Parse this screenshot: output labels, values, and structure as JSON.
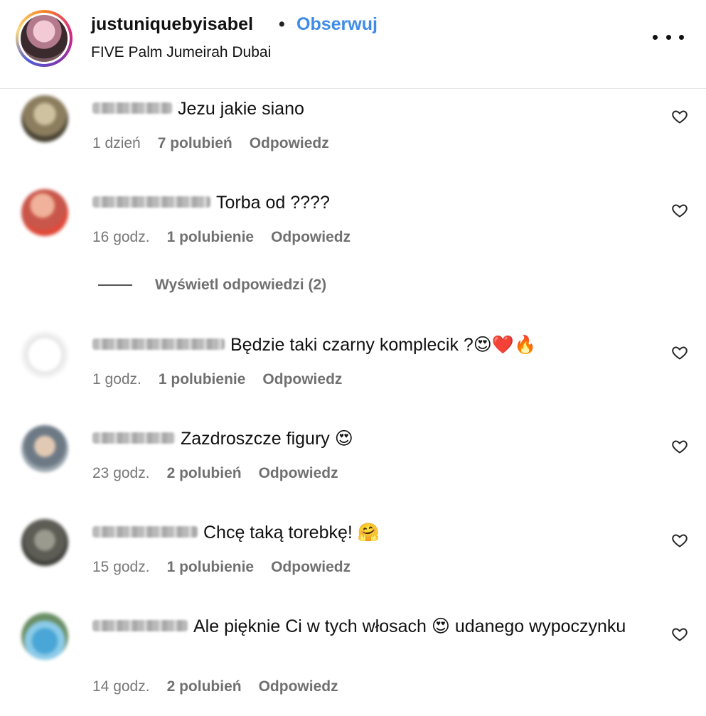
{
  "header": {
    "username": "justuniquebyisabel",
    "separator": "•",
    "follow_label": "Obserwuj",
    "location": "FIVE Palm Jumeirah Dubai",
    "more_icon": "more-horizontal-icon"
  },
  "comments": [
    {
      "text": "Jezu jakie siano",
      "time": "1 dzień",
      "likes": "7 polubień",
      "reply": "Odpowiedz"
    },
    {
      "text": "Torba od ????",
      "time": "16 godz.",
      "likes": "1 polubienie",
      "reply": "Odpowiedz"
    },
    {
      "text": "Będzie taki czarny komplecik ?😍❤️🔥",
      "time": "1 godz.",
      "likes": "1 polubienie",
      "reply": "Odpowiedz"
    },
    {
      "text": "Zazdroszcze figury 😍",
      "time": "23 godz.",
      "likes": "2 polubień",
      "reply": "Odpowiedz"
    },
    {
      "text": "Chcę taką torebkę! 🤗",
      "time": "15 godz.",
      "likes": "1 polubienie",
      "reply": "Odpowiedz"
    },
    {
      "text": "Ale pięknie Ci w tych włosach 😍 udanego wypoczynku",
      "time": "14 godz.",
      "likes": "2 polubień",
      "reply": "Odpowiedz"
    }
  ],
  "view_replies": "Wyświetl odpowiedzi (2)",
  "colors": {
    "accent": "#3f8ce8",
    "meta": "#707070"
  }
}
